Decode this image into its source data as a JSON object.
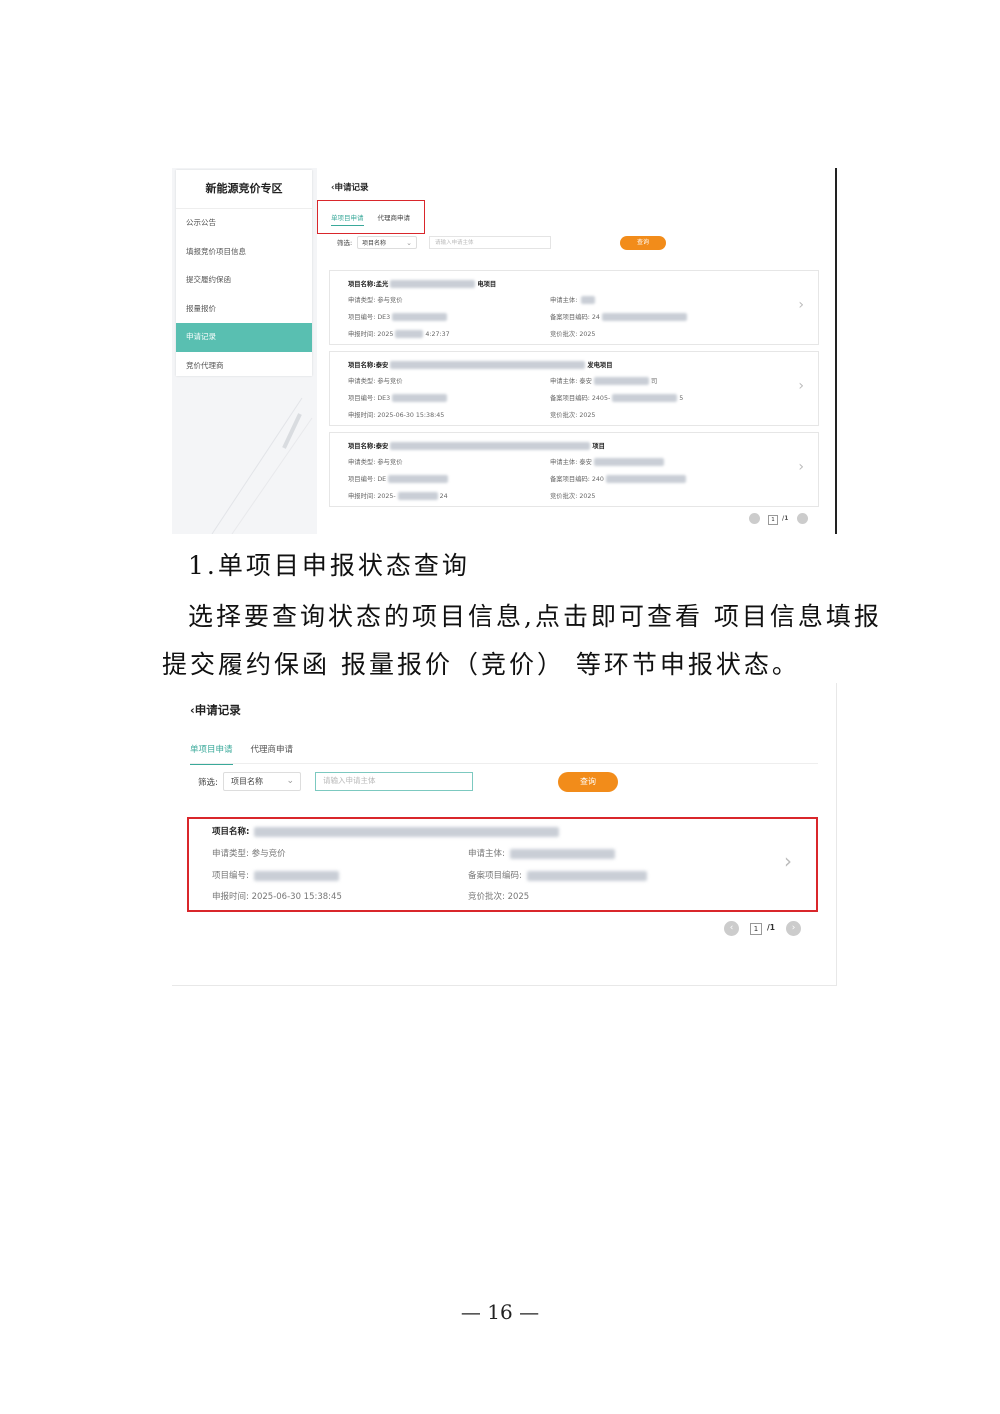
{
  "screenshot1": {
    "sidebar": {
      "title": "新能源竞价专区",
      "items": [
        {
          "label": "公示公告",
          "active": false
        },
        {
          "label": "填报竞价项目信息",
          "active": false
        },
        {
          "label": "提交履约保函",
          "active": false
        },
        {
          "label": "报量报价",
          "active": false
        },
        {
          "label": "申请记录",
          "active": true
        },
        {
          "label": "竞价代理商",
          "active": false
        }
      ]
    },
    "main": {
      "title": "申请记录",
      "tabs": [
        {
          "label": "单项目申请",
          "active": true
        },
        {
          "label": "代理商申请",
          "active": false
        }
      ],
      "filter_label": "筛选:",
      "select_value": "项目名称",
      "search_placeholder": "请输入申请主体",
      "query_button": "查询",
      "cards": [
        {
          "name_label": "项目名称:",
          "name_prefix": "孟光",
          "name_suffix": "电项目",
          "type_label": "申请类型:",
          "type_value": "参与竞价",
          "code_label": "项目编号:",
          "code_prefix": "DE3",
          "time_label": "申报时间:",
          "time_prefix": "2025",
          "time_suffix": "4:27:37",
          "subject_label": "申请主体:",
          "subject_value": "",
          "record_label": "备案项目编码:",
          "record_prefix": "24",
          "batch_label": "竞价批次:",
          "batch_value": "2025"
        },
        {
          "name_label": "项目名称:",
          "name_prefix": "泰安",
          "name_suffix": "发电项目",
          "type_label": "申请类型:",
          "type_value": "参与竞价",
          "code_label": "项目编号:",
          "code_prefix": "DE3",
          "time_label": "申报时间:",
          "time_prefix": "2025-06-30 15:38:45",
          "time_suffix": "",
          "subject_label": "申请主体:",
          "subject_value": "泰安",
          "subject_suffix": "司",
          "record_label": "备案项目编码:",
          "record_prefix": "2405-",
          "record_suffix": "5",
          "batch_label": "竞价批次:",
          "batch_value": "2025"
        },
        {
          "name_label": "项目名称:",
          "name_prefix": "泰安",
          "name_suffix": "项目",
          "type_label": "申请类型:",
          "type_value": "参与竞价",
          "code_label": "项目编号:",
          "code_prefix": "DE",
          "time_label": "申报时间:",
          "time_prefix": "2025-",
          "time_suffix": "24",
          "subject_label": "申请主体:",
          "subject_value": "泰安",
          "record_label": "备案项目编码:",
          "record_prefix": "240",
          "batch_label": "竞价批次:",
          "batch_value": "2025"
        }
      ],
      "pagination": {
        "current": "1",
        "total": "/1"
      }
    }
  },
  "heading": "1.单项目申报状态查询",
  "paragraph_line1": "选择要查询状态的项目信息,点击即可查看 项目信息填报",
  "paragraph_line2": "提交履约保函   报量报价（竞价） 等环节申报状态。",
  "screenshot2": {
    "title": "申请记录",
    "tabs": [
      {
        "label": "单项目申请",
        "active": true
      },
      {
        "label": "代理商申请",
        "active": false
      }
    ],
    "filter_label": "筛选:",
    "select_value": "项目名称",
    "search_placeholder": "请输入申请主体",
    "query_button": "查询",
    "card": {
      "name_label": "项目名称:",
      "type_label": "申请类型:",
      "type_value": "参与竞价",
      "code_label": "项目编号:",
      "time_label": "申报时间:",
      "time_value": "2025-06-30 15:38:45",
      "subject_label": "申请主体:",
      "record_label": "备案项目编码:",
      "batch_label": "竞价批次:",
      "batch_value": "2025"
    },
    "pagination": {
      "current": "1",
      "total": "/1"
    }
  },
  "page_number": "— 16 —"
}
